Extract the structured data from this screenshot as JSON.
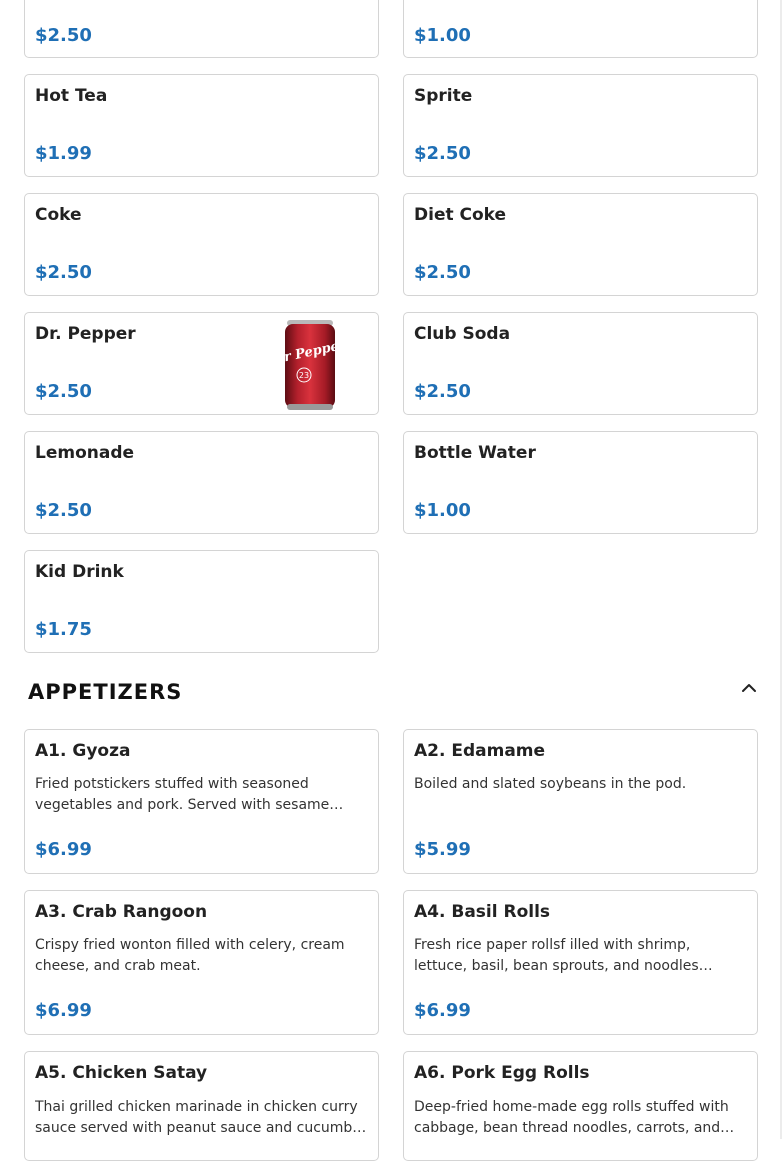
{
  "drinks_top": [
    {
      "price": "$2.50"
    },
    {
      "price": "$1.00"
    }
  ],
  "drinks": [
    {
      "name": "Hot Tea",
      "price": "$1.99"
    },
    {
      "name": "Sprite",
      "price": "$2.50"
    },
    {
      "name": "Coke",
      "price": "$2.50"
    },
    {
      "name": "Diet Coke",
      "price": "$2.50"
    },
    {
      "name": "Dr. Pepper",
      "price": "$2.50",
      "image_label": "Dr Pepper",
      "image_badge": "23"
    },
    {
      "name": "Club Soda",
      "price": "$2.50"
    },
    {
      "name": "Lemonade",
      "price": "$2.50"
    },
    {
      "name": "Bottle Water",
      "price": "$1.00"
    },
    {
      "name": "Kid Drink",
      "price": "$1.75"
    }
  ],
  "appetizers": {
    "title": "APPETIZERS",
    "collapse_icon": "chevron-up-icon",
    "items": [
      {
        "name": "A1. Gyoza",
        "description": "Fried potstickers stuffed with seasoned vegetables and pork. Served with sesame…",
        "price": "$6.99"
      },
      {
        "name": "A2. Edamame",
        "description": "Boiled and slated soybeans in the pod.",
        "price": "$5.99"
      },
      {
        "name": "A3. Crab Rangoon",
        "description": "Crispy fried wonton filled with celery, cream cheese, and crab meat.",
        "price": "$6.99"
      },
      {
        "name": "A4. Basil Rolls",
        "description": "Fresh rice paper rollsf illed with shrimp, lettuce, basil, bean sprouts, and noodles…",
        "price": "$6.99"
      },
      {
        "name": "A5. Chicken Satay",
        "description": "Thai grilled chicken marinade in chicken curry sauce served with peanut sauce and cucumb…",
        "price": ""
      },
      {
        "name": "A6. Pork Egg Rolls",
        "description": "Deep-fried home-made egg rolls stuffed with cabbage, bean thread noodles, carrots, and…",
        "price": ""
      }
    ]
  },
  "colors": {
    "price": "#1f6fb5",
    "border": "#d4d4d4"
  }
}
